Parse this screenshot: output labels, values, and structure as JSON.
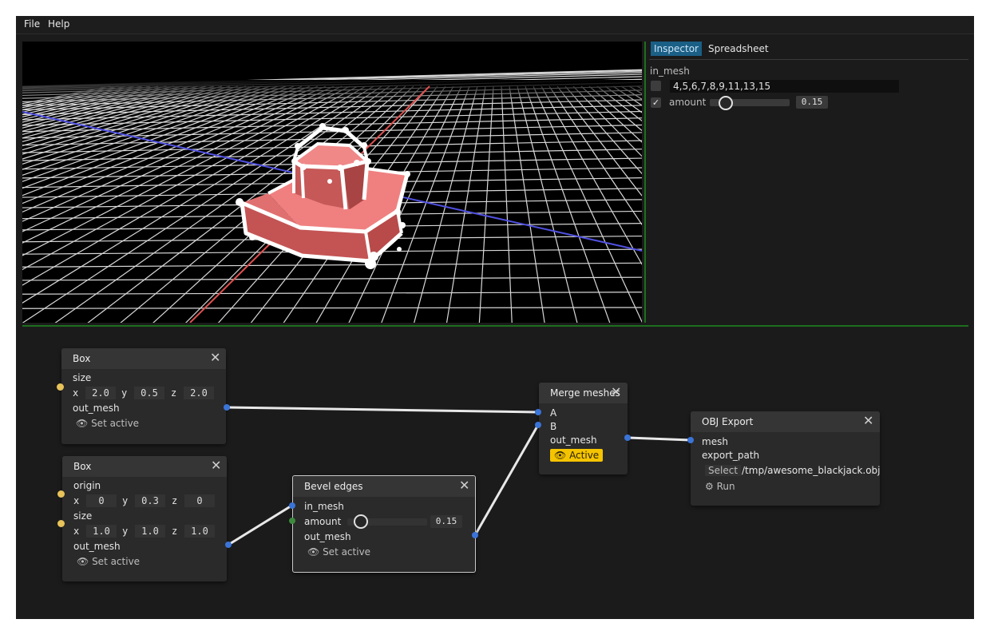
{
  "menubar": {
    "file": "File",
    "help": "Help"
  },
  "inspector": {
    "tabs": [
      {
        "label": "Inspector",
        "active": true
      },
      {
        "label": "Spreadsheet",
        "active": false
      }
    ],
    "section_title": "in_mesh",
    "selection_value": "4,5,6,7,8,9,11,13,15",
    "amount_label": "amount",
    "amount_checked": true,
    "amount_value": "0.15",
    "amount_fraction": 0.15
  },
  "nodes": {
    "box1": {
      "title": "Box",
      "size_label": "size",
      "x_label": "x",
      "x": "2.0",
      "y_label": "y",
      "y": "0.5",
      "z_label": "z",
      "z": "2.0",
      "out_label": "out_mesh",
      "set_active": "Set active"
    },
    "box2": {
      "title": "Box",
      "origin_label": "origin",
      "ox": "0",
      "oy": "0.3",
      "oz": "0",
      "size_label": "size",
      "sx": "1.0",
      "sy": "1.0",
      "sz": "1.0",
      "x_label": "x",
      "y_label": "y",
      "z_label": "z",
      "out_label": "out_mesh",
      "set_active": "Set active"
    },
    "bevel": {
      "title": "Bevel edges",
      "in_label": "in_mesh",
      "amount_label": "amount",
      "amount_value": "0.15",
      "out_label": "out_mesh",
      "set_active": "Set active"
    },
    "merge": {
      "title": "Merge meshes",
      "a_label": "A",
      "b_label": "B",
      "out_label": "out_mesh",
      "active_label": "Active"
    },
    "obj": {
      "title": "OBJ Export",
      "mesh_label": "mesh",
      "path_label": "export_path",
      "select_label": "Select",
      "path_value": "/tmp/awesome_blackjack.obj",
      "run_label": "Run"
    }
  },
  "colors": {
    "accent_tab": "#1a5f86",
    "active_badge": "#f5c400",
    "separator": "#1e6e1e",
    "mesh": "#e87272",
    "axis_x": "#e05050",
    "axis_z": "#5050e0",
    "port_input": "#e8c35a",
    "port_mesh": "#3a74d8",
    "port_scalar": "#3d8a3d"
  },
  "icons": {
    "close": "close-icon",
    "eye": "eye-icon",
    "gear": "gear-icon",
    "check": "check-icon"
  }
}
